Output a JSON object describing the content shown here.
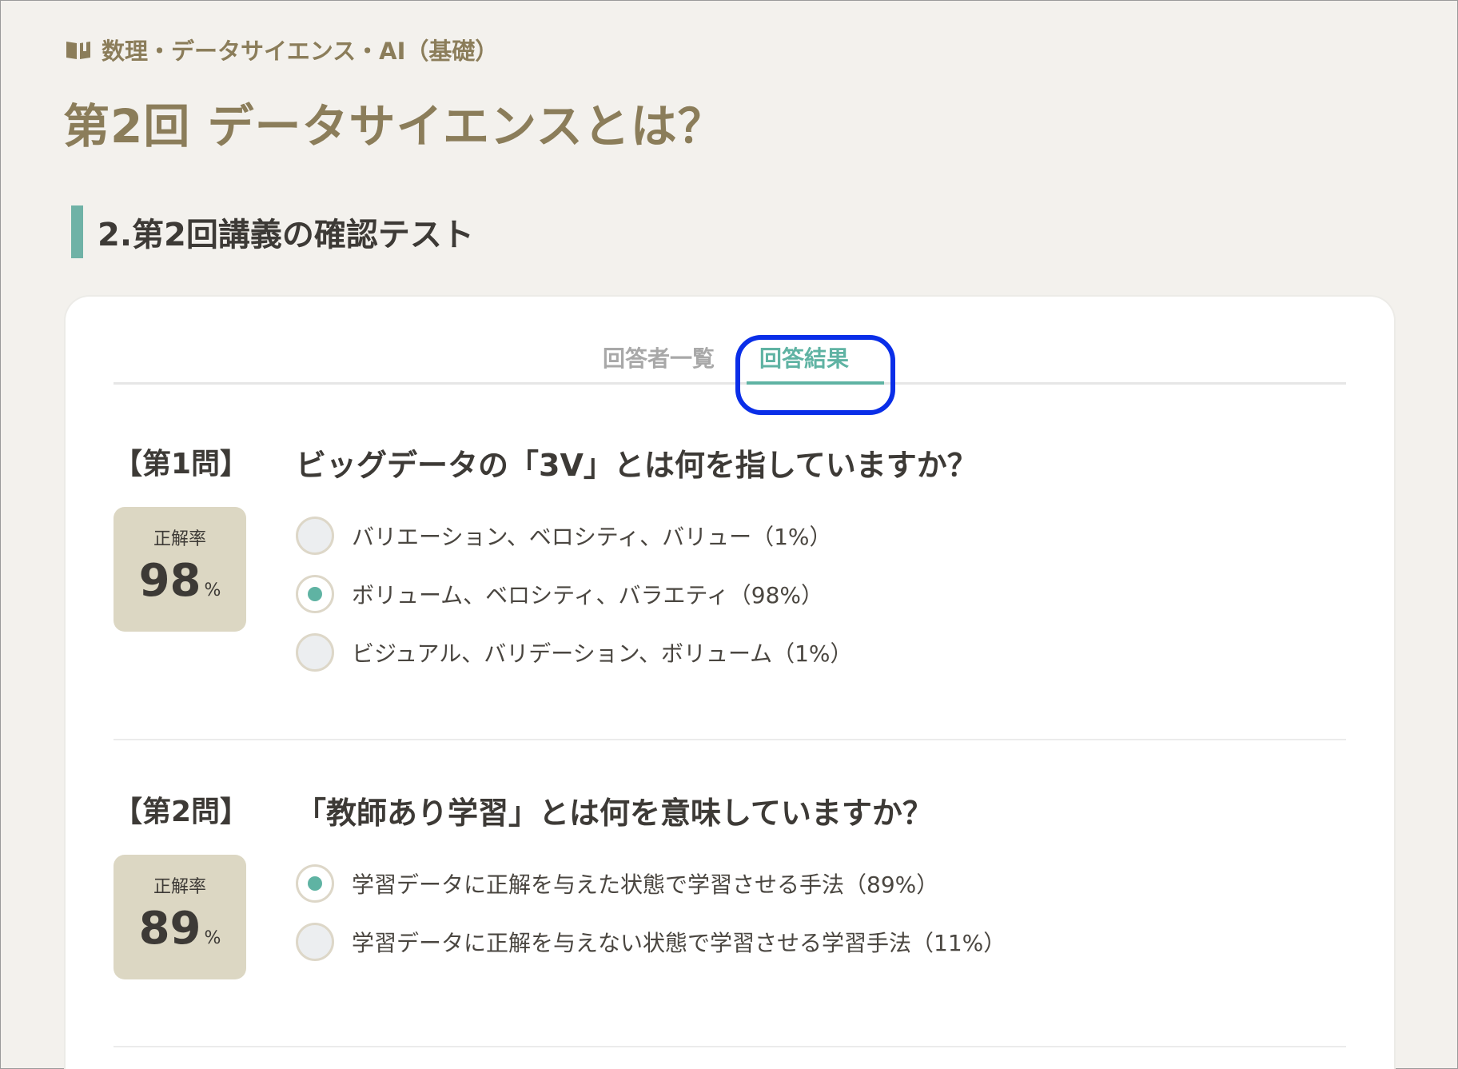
{
  "header": {
    "course": "数理・データサイエンス・AI（基礎）",
    "lecture_title": "第2回 データサイエンスとは？",
    "section": "2.第2回講義の確認テスト"
  },
  "tabs": {
    "respondents": "回答者一覧",
    "results": "回答結果"
  },
  "questions": [
    {
      "number": "【第1問】",
      "text": "ビッグデータの「3V」とは何を指していますか？",
      "rate_label": "正解率",
      "rate_value": "98",
      "rate_unit": "%",
      "options": [
        {
          "text": "バリエーション、ベロシティ、バリュー（1%）",
          "selected": false
        },
        {
          "text": "ボリューム、ベロシティ、バラエティ（98%）",
          "selected": true
        },
        {
          "text": "ビジュアル、バリデーション、ボリューム（1%）",
          "selected": false
        }
      ]
    },
    {
      "number": "【第2問】",
      "text": "「教師あり学習」とは何を意味していますか？",
      "rate_label": "正解率",
      "rate_value": "89",
      "rate_unit": "%",
      "options": [
        {
          "text": "学習データに正解を与えた状態で学習させる手法（89%）",
          "selected": true
        },
        {
          "text": "学習データに正解を与えない状態で学習させる学習手法（11%）",
          "selected": false
        }
      ]
    }
  ],
  "colors": {
    "accent": "#5fb3a3",
    "title": "#8b7d5a",
    "rate_box": "#dcd7c3",
    "focus_ring": "#0a2ee8"
  }
}
